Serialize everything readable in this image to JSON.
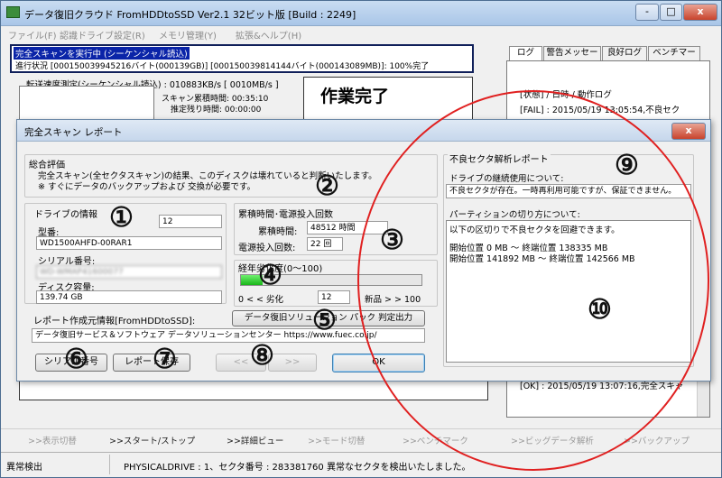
{
  "window": {
    "title": "データ復旧クラウド FromHDDtoSSD Ver2.1 32ビット版 [Build : 2249]",
    "minimize_label": "-",
    "maximize_label": "□",
    "close_label": "x"
  },
  "menu": [
    "ファイル(F)",
    "認識ドライブ設定(R)",
    "メモリ管理(Y)",
    "拡張&ヘルプ(H)"
  ],
  "scan": {
    "status_highlight": "完全スキャンを実行中 (シーケンシャル読込)",
    "progress": "進行状況 [000150039945216バイト(000139GB)] [000150039814144バイト(000143089MB)]: 100%完了",
    "speed": "転送速度測定(シーケンシャル読込) : 010883KB/s [ 0010MB/s ]",
    "elapsed": "スキャン累積時間: 00:35:10",
    "remaining": "推定残り時間: 00:00:00",
    "done_label": "作業完了"
  },
  "right_panel": {
    "tabs": [
      "ログ",
      "警告メッセージ",
      "良好ログ",
      "ベンチマーク"
    ],
    "log_header": "[状態] / 日時 / 動作ログ",
    "log_lines": [
      "[FAIL] : 2015/05/19 13:05:54,不良セク",
      "[OK] : 2015/05/19 13:07:16,完全スキャ"
    ]
  },
  "dialog": {
    "title": "完全スキャン レポート",
    "close_label": "x",
    "overall_title": "総合評価",
    "overall_text": "完全スキャン(全セクタスキャン)の結果、このディスクは壊れていると判断いたします。",
    "overall_text2": "※ すぐにデータのバックアップおよび 交換が必要です。",
    "drive_info_title": "ドライブの情報",
    "drive_number": "12",
    "model_label": "型番:",
    "model_value": "WD1500AHFD-00RAR1",
    "serial_label": "シリアル番号:",
    "serial_value": "WD-WMAP41600077",
    "capacity_label": "ディスク容量:",
    "capacity_value": "139.74 GB",
    "usage_title": "累積時間･電源投入回数",
    "hours_label": "累積時間:",
    "hours_value": "48512 時間",
    "power_label": "電源投入回数:",
    "power_value": "22 回",
    "degradation_title": "経年劣化度(0～100)",
    "degradation_value": 12,
    "degradation_value_text": "12",
    "degradation_low": "0 < < 劣化",
    "degradation_high": "新品 > > 100",
    "creator_label": "レポート作成元情報[FromHDDtoSSD]:",
    "backup_button": "データ復旧ソリューション パック 判定出力",
    "creator_value": "データ復旧サービス＆ソフトウェア データソリューションセンター https://www.fuec.co.jp/",
    "serial_button": "シリアル番号",
    "save_button": "レポート保存",
    "prev_button": "<<",
    "next_button": ">>",
    "ok_button": "OK",
    "bad_sector_title": "不良セクタ解析レポート",
    "continue_label": "ドライブの継続使用について:",
    "continue_value": "不良セクタが存在。一時再利用可能ですが、保証できません。",
    "partition_label": "パーティションの切り方について:",
    "partition_line1": "以下の区切りで不良セクタを回避できます。",
    "partition_line2": "開始位置 0 MB ～ 終端位置 138335 MB",
    "partition_line3": "開始位置 141892 MB ～ 終端位置 142566 MB"
  },
  "annotations": [
    "①",
    "②",
    "③",
    "④",
    "⑤",
    "⑥",
    "⑦",
    "⑧",
    "⑨",
    "⑩"
  ],
  "bottom_nav": [
    ">>表示切替",
    ">>スタート/ストップ",
    ">>詳細ビュー",
    ">>モード切替",
    ">>ベンチマーク",
    ">>ビッグデータ解析",
    ">>バックアップ"
  ],
  "status": {
    "left": "異常検出",
    "message": "PHYSICALDRIVE : 1、セクタ番号 : 283381760 異常なセクタを検出いたしました。"
  },
  "colors": {
    "highlight": "#0a24a8",
    "progress_green": "#19b619",
    "annotation_circle": "#e02020"
  }
}
